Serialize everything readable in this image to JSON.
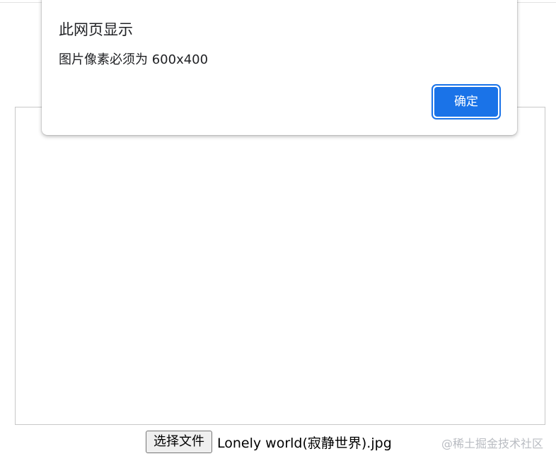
{
  "dialog": {
    "title": "此网页显示",
    "message": "图片像素必须为 600x400",
    "ok_label": "确定"
  },
  "file_input": {
    "button_label": "选择文件",
    "file_name": "Lonely world(寂静世界).jpg"
  },
  "watermark": "@稀土掘金技术社区",
  "colors": {
    "accent": "#1a73e8",
    "preview_border": "#c8c8c8",
    "watermark": "#b9bcc2"
  }
}
